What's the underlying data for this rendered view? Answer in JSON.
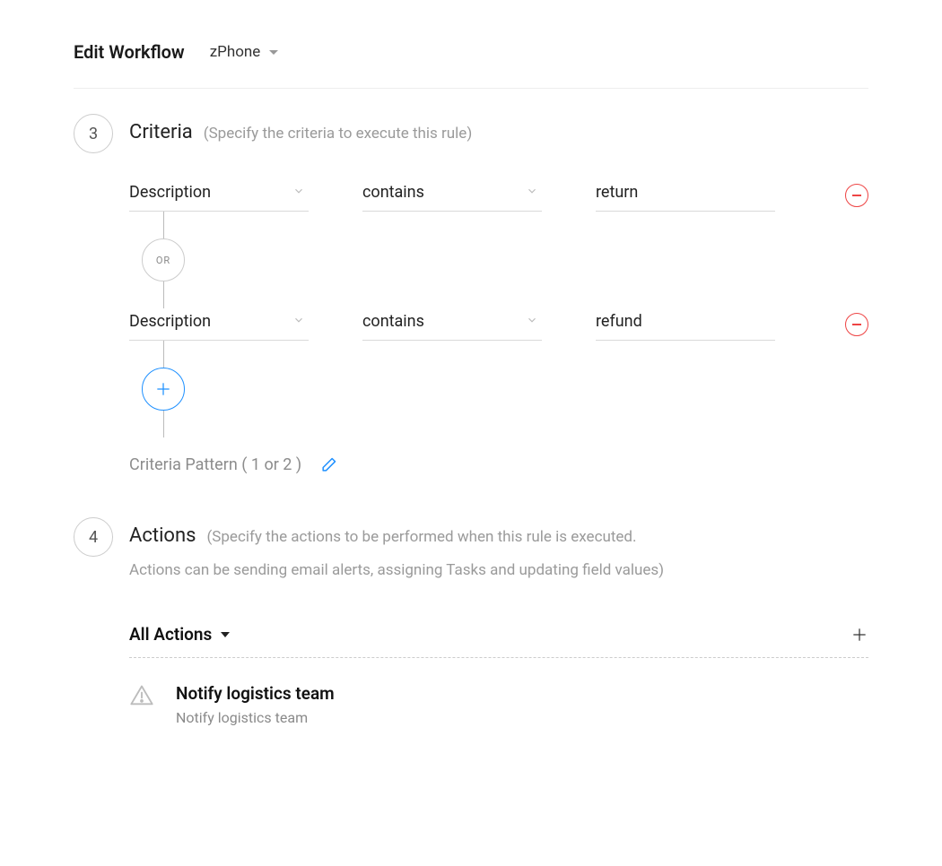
{
  "header": {
    "title": "Edit Workflow",
    "workflow_select": "zPhone"
  },
  "criteria": {
    "step_number": "3",
    "title": "Criteria",
    "subtitle": "(Specify the criteria to execute this rule)",
    "rows": [
      {
        "field": "Description",
        "operator": "contains",
        "value": "return"
      },
      {
        "field": "Description",
        "operator": "contains",
        "value": "refund"
      }
    ],
    "connector": "OR",
    "pattern_label": "Criteria Pattern ( 1 or 2 )"
  },
  "actions": {
    "step_number": "4",
    "title": "Actions",
    "subtitle_line1": "(Specify the actions to be performed when this rule is executed.",
    "subtitle_line2": "Actions can be sending email alerts, assigning Tasks and updating field values)",
    "filter_label": "All Actions",
    "items": [
      {
        "title": "Notify logistics team",
        "subtitle": "Notify logistics team"
      }
    ]
  }
}
